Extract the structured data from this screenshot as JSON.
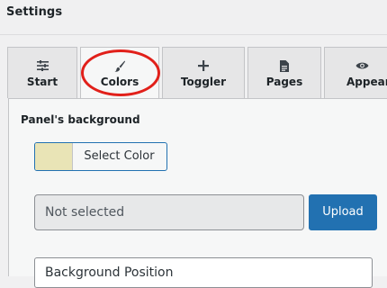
{
  "page": {
    "title": "Settings"
  },
  "tabs": [
    {
      "label": "Start",
      "icon": "sliders-icon"
    },
    {
      "label": "Colors",
      "icon": "paintbrush-icon",
      "active": true
    },
    {
      "label": "Toggler",
      "icon": "plus-icon"
    },
    {
      "label": "Pages",
      "icon": "document-icon"
    },
    {
      "label": "Appear",
      "icon": "eye-icon"
    }
  ],
  "panel": {
    "background_label": "Panel's background",
    "color_picker": {
      "button_label": "Select Color",
      "value": "#e9e4b6"
    },
    "file": {
      "status": "Not selected",
      "upload_label": "Upload"
    },
    "position_select": {
      "value": "Background Position"
    }
  },
  "colors": {
    "accent": "#2271b1",
    "annotation": "#e1201a"
  }
}
